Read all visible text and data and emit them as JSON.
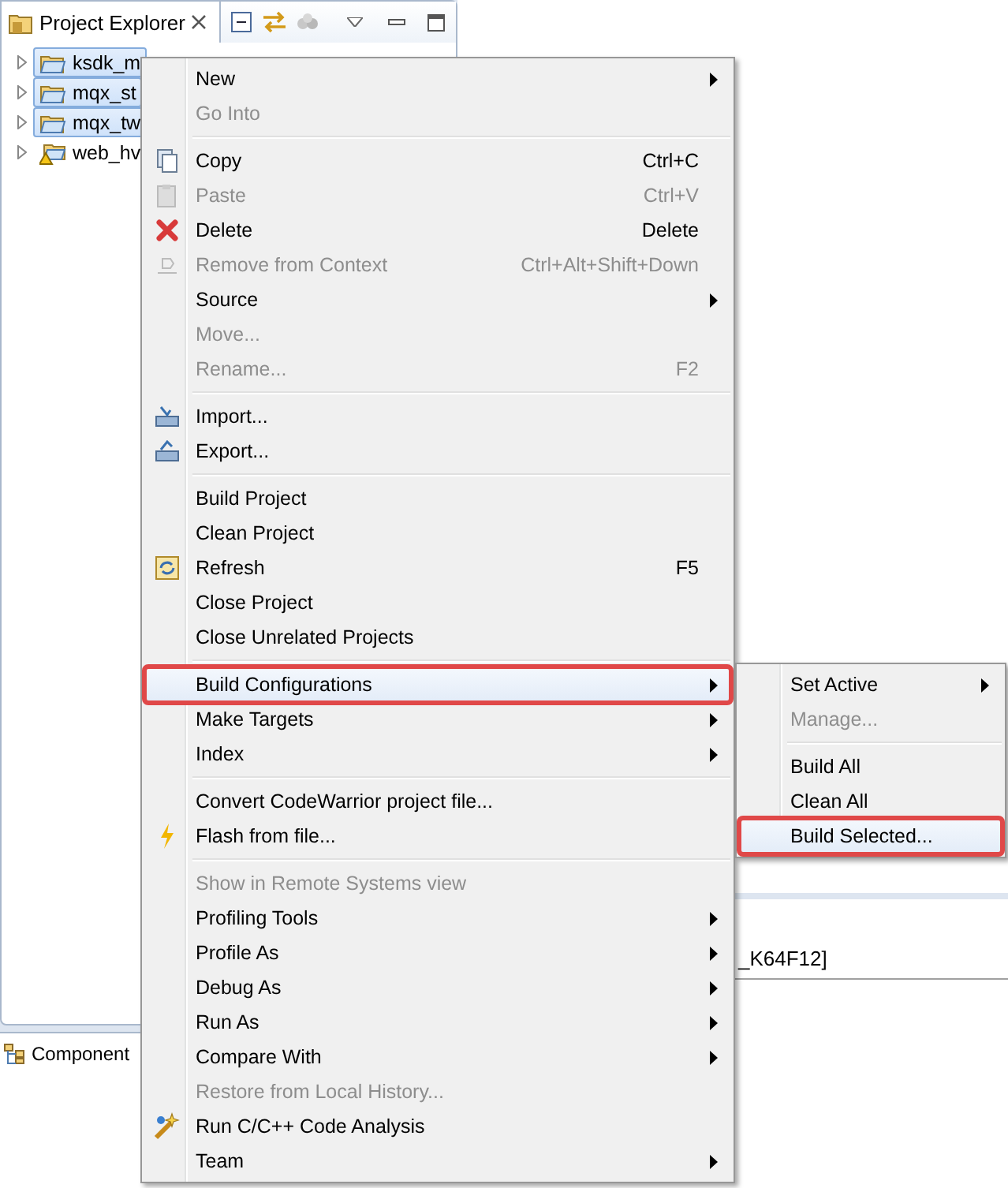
{
  "explorer": {
    "title": "Project Explorer",
    "tree": [
      {
        "label": "ksdk_m",
        "selected": true,
        "warning": false
      },
      {
        "label": "mqx_st",
        "selected": true,
        "warning": false
      },
      {
        "label": "mqx_tw",
        "selected": true,
        "warning": false
      },
      {
        "label": "web_hv",
        "selected": false,
        "warning": true
      }
    ]
  },
  "lower_panel": {
    "text": "_K64F12]"
  },
  "components_panel": {
    "title": "Component"
  },
  "context_menu": {
    "groups": [
      [
        {
          "label": "New",
          "disabled": false,
          "submenu": true,
          "highlighted": false
        },
        {
          "label": "Go Into",
          "disabled": true,
          "submenu": false,
          "highlighted": false
        }
      ],
      [
        {
          "label": "Copy",
          "shortcut": "Ctrl+C",
          "disabled": false,
          "submenu": false,
          "highlighted": false
        },
        {
          "label": "Paste",
          "shortcut": "Ctrl+V",
          "disabled": true,
          "submenu": false,
          "highlighted": false
        },
        {
          "label": "Delete",
          "shortcut": "Delete",
          "disabled": false,
          "submenu": false,
          "highlighted": false
        },
        {
          "label": "Remove from Context",
          "shortcut": "Ctrl+Alt+Shift+Down",
          "disabled": true,
          "submenu": false,
          "highlighted": false
        },
        {
          "label": "Source",
          "disabled": false,
          "submenu": true,
          "highlighted": false
        },
        {
          "label": "Move...",
          "disabled": true,
          "submenu": false,
          "highlighted": false
        },
        {
          "label": "Rename...",
          "shortcut": "F2",
          "disabled": true,
          "submenu": false,
          "highlighted": false
        }
      ],
      [
        {
          "label": "Import...",
          "disabled": false,
          "submenu": false,
          "highlighted": false
        },
        {
          "label": "Export...",
          "disabled": false,
          "submenu": false,
          "highlighted": false
        }
      ],
      [
        {
          "label": "Build Project",
          "disabled": false,
          "submenu": false,
          "highlighted": false
        },
        {
          "label": "Clean Project",
          "disabled": false,
          "submenu": false,
          "highlighted": false
        },
        {
          "label": "Refresh",
          "shortcut": "F5",
          "disabled": false,
          "submenu": false,
          "highlighted": false
        },
        {
          "label": "Close Project",
          "disabled": false,
          "submenu": false,
          "highlighted": false
        },
        {
          "label": "Close Unrelated Projects",
          "disabled": false,
          "submenu": false,
          "highlighted": false
        }
      ],
      [
        {
          "label": "Build Configurations",
          "disabled": false,
          "submenu": true,
          "highlighted": true
        },
        {
          "label": "Make Targets",
          "disabled": false,
          "submenu": true,
          "highlighted": false
        },
        {
          "label": "Index",
          "disabled": false,
          "submenu": true,
          "highlighted": false
        }
      ],
      [
        {
          "label": "Convert CodeWarrior project file...",
          "disabled": false,
          "submenu": false,
          "highlighted": false
        },
        {
          "label": "Flash from file...",
          "disabled": false,
          "submenu": false,
          "highlighted": false
        }
      ],
      [
        {
          "label": "Show in Remote Systems view",
          "disabled": true,
          "submenu": false,
          "highlighted": false
        },
        {
          "label": "Profiling Tools",
          "disabled": false,
          "submenu": true,
          "highlighted": false
        },
        {
          "label": "Profile As",
          "disabled": false,
          "submenu": true,
          "highlighted": false
        },
        {
          "label": "Debug As",
          "disabled": false,
          "submenu": true,
          "highlighted": false
        },
        {
          "label": "Run As",
          "disabled": false,
          "submenu": true,
          "highlighted": false
        },
        {
          "label": "Compare With",
          "disabled": false,
          "submenu": true,
          "highlighted": false
        },
        {
          "label": "Restore from Local History...",
          "disabled": true,
          "submenu": false,
          "highlighted": false
        },
        {
          "label": "Run C/C++ Code Analysis",
          "disabled": false,
          "submenu": false,
          "highlighted": false
        },
        {
          "label": "Team",
          "disabled": false,
          "submenu": true,
          "highlighted": false
        }
      ]
    ]
  },
  "submenu": {
    "groups": [
      [
        {
          "label": "Set Active",
          "disabled": false,
          "submenu": true,
          "highlighted": false
        },
        {
          "label": "Manage...",
          "disabled": true,
          "submenu": false,
          "highlighted": false
        }
      ],
      [
        {
          "label": "Build All",
          "disabled": false,
          "submenu": false,
          "highlighted": false
        },
        {
          "label": "Clean All",
          "disabled": false,
          "submenu": false,
          "highlighted": false
        },
        {
          "label": "Build Selected...",
          "disabled": false,
          "submenu": false,
          "highlighted": true
        }
      ]
    ]
  }
}
